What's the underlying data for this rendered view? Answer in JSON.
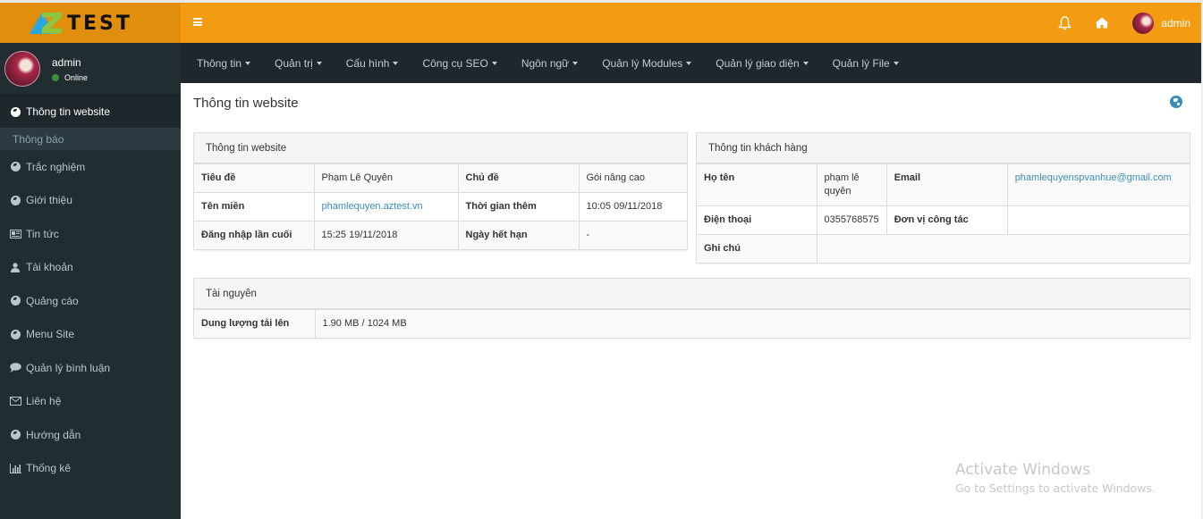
{
  "brand": {
    "logo_letters": "AZ",
    "logo_text": "TEST"
  },
  "sidebar": {
    "user": {
      "name": "admin",
      "status": "Online"
    },
    "items": [
      {
        "label": "Thông tin website",
        "icon": "globe-icon",
        "active": true
      },
      {
        "label": "Trắc nghiệm",
        "icon": "globe-icon"
      },
      {
        "label": "Giới thiệu",
        "icon": "globe-icon"
      },
      {
        "label": "Tin tức",
        "icon": "newspaper-icon"
      },
      {
        "label": "Tài khoản",
        "icon": "user-icon"
      },
      {
        "label": "Quảng cáo",
        "icon": "globe-icon"
      },
      {
        "label": "Menu Site",
        "icon": "globe-icon"
      },
      {
        "label": "Quản lý bình luận",
        "icon": "comment-icon"
      },
      {
        "label": "Liên hệ",
        "icon": "envelope-icon"
      },
      {
        "label": "Hướng dẫn",
        "icon": "globe-icon"
      },
      {
        "label": "Thống kê",
        "icon": "bar-chart-icon"
      }
    ],
    "submenu": [
      {
        "label": "Thông báo"
      }
    ]
  },
  "header": {
    "user_name": "admin",
    "icons": [
      "menu-toggle-icon",
      "bell-icon",
      "home-icon"
    ]
  },
  "topnav": {
    "items": [
      {
        "label": "Thông tin"
      },
      {
        "label": "Quản trị"
      },
      {
        "label": "Cấu hình"
      },
      {
        "label": "Công cụ SEO"
      },
      {
        "label": "Ngôn ngữ"
      },
      {
        "label": "Quản lý Modules"
      },
      {
        "label": "Quản lý giao diện"
      },
      {
        "label": "Quản lý File"
      }
    ]
  },
  "page": {
    "title": "Thông tin website"
  },
  "website_info": {
    "heading": "Thông tin website",
    "rows": [
      [
        "Tiêu đề",
        "Phạm Lê Quyên",
        "Chủ đề",
        "Gói nâng cao"
      ],
      [
        "Tên miền",
        "phamlequyen.aztest.vn",
        "Thời gian thêm",
        "10:05 09/11/2018"
      ],
      [
        "Đăng nhập lần cuối",
        "15:25 19/11/2018",
        "Ngày hết hạn",
        "-"
      ]
    ]
  },
  "customer_info": {
    "heading": "Thông tin khách hàng",
    "rows": [
      [
        "Họ tên",
        "phạm lê quyên",
        "Email",
        "phamlequyenspvanhue@gmail.com"
      ],
      [
        "Điện thoại",
        "0355768575",
        "Đơn vị công tác",
        ""
      ],
      [
        "Ghi chú",
        ""
      ]
    ]
  },
  "resources": {
    "heading": "Tài nguyên",
    "rows": [
      [
        "Dung lượng tải lên",
        "1.90 MB / 1024 MB"
      ]
    ]
  },
  "watermark": {
    "title": "Activate Windows",
    "subtitle": "Go to Settings to activate Windows."
  },
  "colors": {
    "header": "#f39c12",
    "logo_bg": "#e08e0b",
    "sidebar": "#222d32",
    "topnav": "#1f262d",
    "link": "#3c8dbc"
  }
}
